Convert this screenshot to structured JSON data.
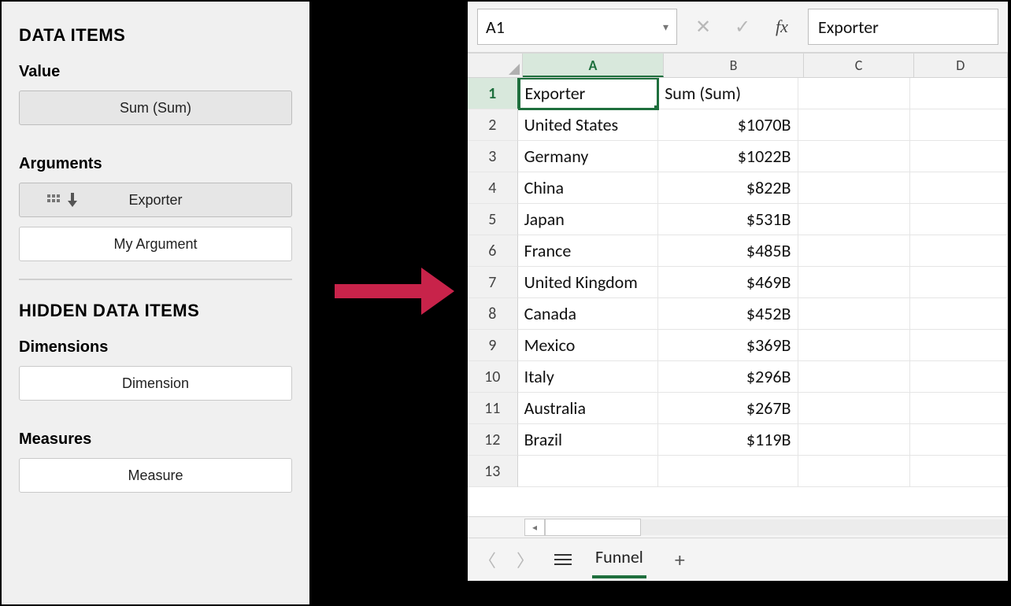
{
  "panel": {
    "h1": "DATA ITEMS",
    "value_label": "Value",
    "value_field": "Sum (Sum)",
    "arguments_label": "Arguments",
    "argument_field": "Exporter",
    "argument_placeholder": "My Argument",
    "h2": "HIDDEN DATA ITEMS",
    "dimensions_label": "Dimensions",
    "dimension_placeholder": "Dimension",
    "measures_label": "Measures",
    "measure_placeholder": "Measure"
  },
  "excel": {
    "namebox": "A1",
    "fx_label": "fx",
    "formula_value": "Exporter",
    "columns": [
      "A",
      "B",
      "C",
      "D"
    ],
    "header_row": {
      "a": "Exporter",
      "b": "Sum (Sum)"
    },
    "rows": [
      {
        "n": "1",
        "a": "Exporter",
        "b": "Sum (Sum)"
      },
      {
        "n": "2",
        "a": "United States",
        "b": "$1070B"
      },
      {
        "n": "3",
        "a": "Germany",
        "b": "$1022B"
      },
      {
        "n": "4",
        "a": "China",
        "b": "$822B"
      },
      {
        "n": "5",
        "a": "Japan",
        "b": "$531B"
      },
      {
        "n": "6",
        "a": "France",
        "b": "$485B"
      },
      {
        "n": "7",
        "a": "United Kingdom",
        "b": "$469B"
      },
      {
        "n": "8",
        "a": "Canada",
        "b": "$452B"
      },
      {
        "n": "9",
        "a": "Mexico",
        "b": "$369B"
      },
      {
        "n": "10",
        "a": "Italy",
        "b": "$296B"
      },
      {
        "n": "11",
        "a": "Australia",
        "b": "$267B"
      },
      {
        "n": "12",
        "a": "Brazil",
        "b": "$119B"
      },
      {
        "n": "13",
        "a": "",
        "b": ""
      }
    ],
    "sheet_tab": "Funnel"
  },
  "chart_data": {
    "type": "table",
    "title": "Exporter vs Sum",
    "columns": [
      "Exporter",
      "Sum (Sum)"
    ],
    "series": [
      {
        "name": "Sum (Sum)",
        "categories": [
          "United States",
          "Germany",
          "China",
          "Japan",
          "France",
          "United Kingdom",
          "Canada",
          "Mexico",
          "Italy",
          "Australia",
          "Brazil"
        ],
        "values": [
          1070,
          1022,
          822,
          531,
          485,
          469,
          452,
          369,
          296,
          267,
          119
        ],
        "unit": "B USD"
      }
    ]
  }
}
